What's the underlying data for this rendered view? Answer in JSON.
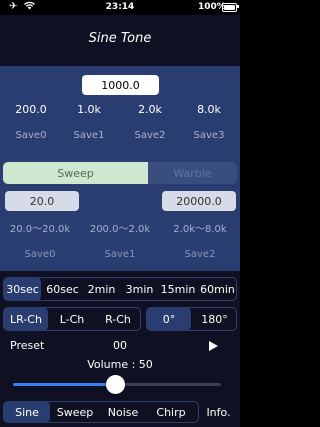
{
  "status": {
    "time": "23:14",
    "battery_pct": "100%",
    "airplane_icon": "airplane-icon",
    "wifi_icon": "wifi-icon"
  },
  "title": "Sine Tone",
  "frequency": "1000.0",
  "presets": [
    "200.0",
    "1.0k",
    "2.0k",
    "8.0k"
  ],
  "saves": [
    "Save0",
    "Save1",
    "Save2",
    "Save3"
  ],
  "mode": {
    "sweep_label": "Sweep",
    "warble_label": "Warble",
    "selected": "Sweep"
  },
  "sweep": {
    "start": "20.0",
    "end": "20000.0",
    "ranges": [
      "20.0～20.0k",
      "200.0～2.0k",
      "2.0k～8.0k"
    ],
    "saves": [
      "Save0",
      "Save1",
      "Save2"
    ]
  },
  "durations": {
    "items": [
      "30sec",
      "60sec",
      "2min",
      "3min",
      "15min",
      "60min"
    ],
    "selected": "30sec"
  },
  "channels": {
    "items": [
      "LR-Ch",
      "L-Ch",
      "R-Ch"
    ],
    "selected": "LR-Ch",
    "phase_items": [
      "0°",
      "180°"
    ],
    "phase_selected": "0°"
  },
  "preset_row": {
    "label": "Preset",
    "value": "00",
    "play_icon": "play-icon"
  },
  "volume": {
    "label": "Volume : 50",
    "value": 50,
    "max": 100
  },
  "tabs": {
    "items": [
      "Sine",
      "Sweep",
      "Noise",
      "Chirp"
    ],
    "selected": "Sine",
    "info_label": "Info."
  },
  "colors": {
    "panel": "#2a3d70",
    "dark": "#0f1021",
    "accent": "#3b7ff0",
    "sweep_selected": "#cfe6cf"
  }
}
